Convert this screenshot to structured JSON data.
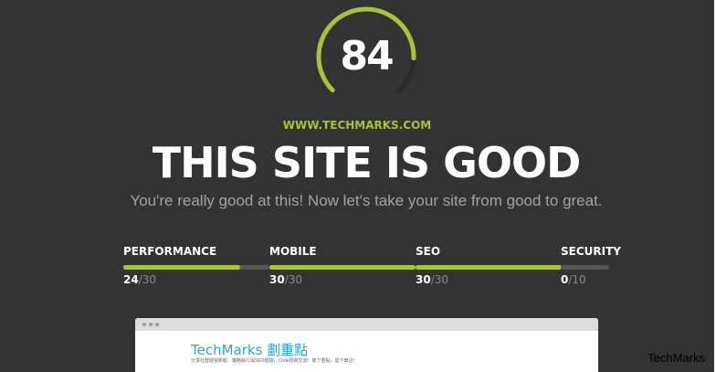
{
  "score": {
    "value": "84",
    "fraction": 0.84
  },
  "site_url": "WWW.TECHMARKS.COM",
  "headline": "THIS SITE IS GOOD",
  "tagline": "You're really good at this! Now let's take your site from good to great.",
  "metrics": [
    {
      "label": "PERFORMANCE",
      "score": "24",
      "max": "/30",
      "fraction": 0.8
    },
    {
      "label": "MOBILE",
      "score": "30",
      "max": "/30",
      "fraction": 1.0
    },
    {
      "label": "SEO",
      "score": "30",
      "max": "/30",
      "fraction": 1.0
    },
    {
      "label": "SECURITY",
      "score": "0",
      "max": "/10",
      "fraction": 0.0
    }
  ],
  "preview": {
    "title": "TechMarks 劃重點",
    "subtitle": "分享社群經營新觀、策略執行與SEO經驗、Code技術交流！寫下重點，留下筆記！"
  },
  "watermark": "TechMarks",
  "colors": {
    "background": "#333333",
    "accent": "#a6c33a",
    "track": "#555555",
    "preview_title": "#2fa3d3"
  }
}
